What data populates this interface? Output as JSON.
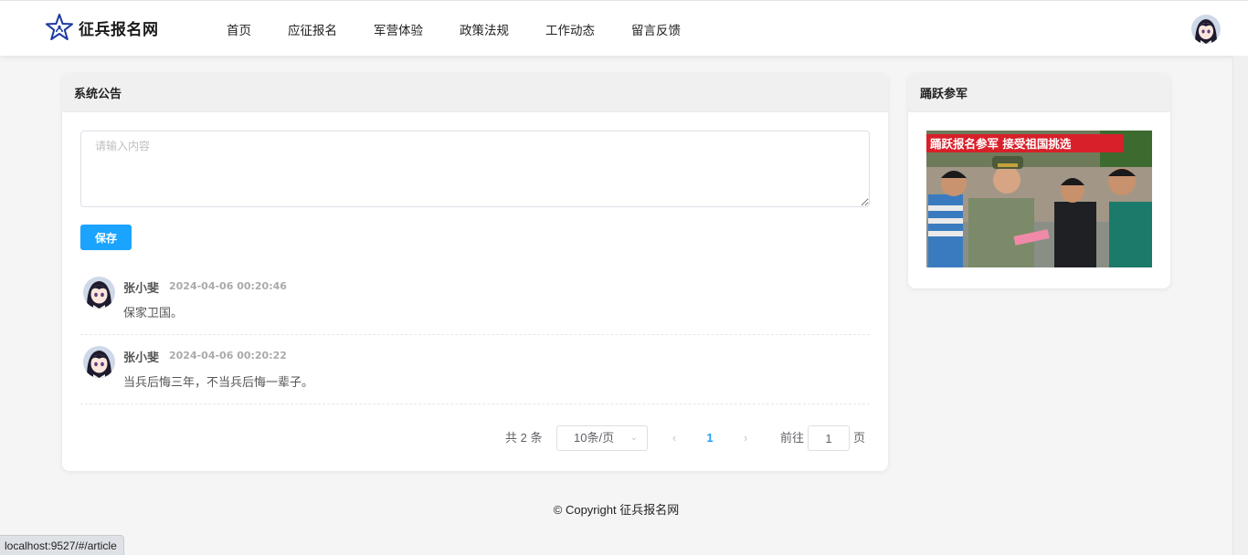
{
  "brand": {
    "name": "征兵报名网"
  },
  "nav": {
    "items": [
      {
        "label": "首页"
      },
      {
        "label": "应征报名"
      },
      {
        "label": "军营体验"
      },
      {
        "label": "政策法规"
      },
      {
        "label": "工作动态"
      },
      {
        "label": "留言反馈"
      }
    ]
  },
  "notice": {
    "title": "系统公告",
    "input_placeholder": "请输入内容",
    "save_label": "保存"
  },
  "comments": [
    {
      "name": "张小斐",
      "time": "2024-04-06 00:20:46",
      "text": "保家卫国。"
    },
    {
      "name": "张小斐",
      "time": "2024-04-06 00:20:22",
      "text": "当兵后悔三年，不当兵后悔一辈子。"
    }
  ],
  "pagination": {
    "total_text": "共 2 条",
    "page_size": "10条/页",
    "current_page": "1",
    "goto_label": "前往",
    "goto_value": "1",
    "page_suffix": "页"
  },
  "side": {
    "title": "踊跃参军",
    "banner_text": "踊跃报名参军  接受祖国挑选"
  },
  "footer": {
    "copyright": "© Copyright 征兵报名网"
  },
  "status_bar": {
    "url": "localhost:9527/#/article"
  },
  "colors": {
    "accent": "#1aa3ff",
    "logo": "#1c3aa0",
    "banner_red": "#d8202a"
  }
}
